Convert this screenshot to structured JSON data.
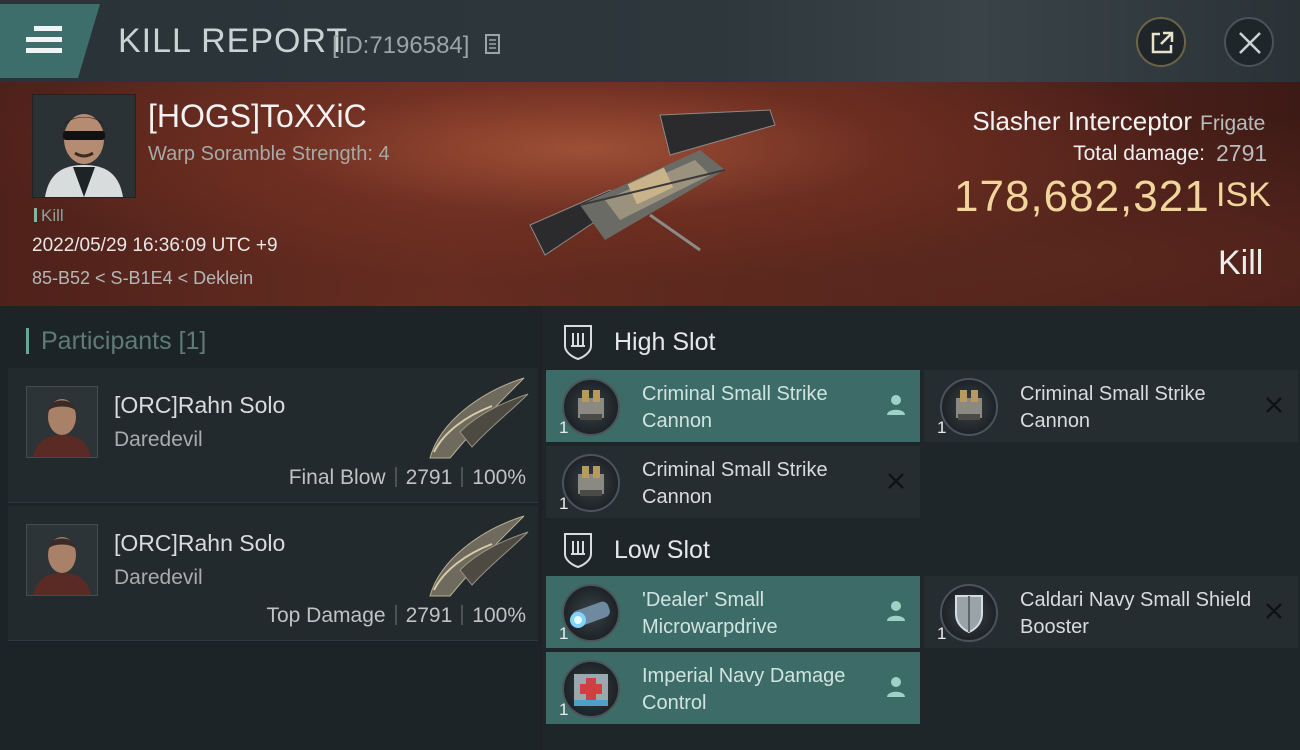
{
  "header": {
    "title": "KILL REPORT",
    "id_label": "[ID:7196584]"
  },
  "victim": {
    "name": "[HOGS]ToXXiC",
    "subtitle": "Warp Soramble Strength: 4",
    "tag": "Kill",
    "datetime": "2022/05/29 16:36:09 UTC +9",
    "location": "85-B52 < S-B1E4 < Deklein",
    "ship_name": "Slasher Interceptor",
    "ship_class": "Frigate",
    "total_damage_label": "Total damage:",
    "total_damage": "2791",
    "isk_value": "178,682,321",
    "isk_unit": "ISK",
    "result": "Kill"
  },
  "participants": {
    "title": "Participants [1]",
    "rows": [
      {
        "name": "[ORC]Rahn Solo",
        "ship": "Daredevil",
        "role": "Final Blow",
        "damage": "2791",
        "percent": "100%"
      },
      {
        "name": "[ORC]Rahn Solo",
        "ship": "Daredevil",
        "role": "Top Damage",
        "damage": "2791",
        "percent": "100%"
      }
    ]
  },
  "fitting": {
    "high_slot_label": "High Slot",
    "low_slot_label": "Low Slot",
    "high_slot": [
      {
        "name": "Criminal Small Strike Cannon",
        "qty": "1",
        "status": "dropped"
      },
      {
        "name": "Criminal Small Strike Cannon",
        "qty": "1",
        "status": "destroyed"
      },
      {
        "name": "Criminal Small Strike Cannon",
        "qty": "1",
        "status": "destroyed"
      }
    ],
    "low_slot": [
      {
        "name": "'Dealer' Small Microwarpdrive",
        "qty": "1",
        "status": "dropped"
      },
      {
        "name": "Caldari Navy Small Shield Booster",
        "qty": "1",
        "status": "destroyed"
      },
      {
        "name": "Imperial Navy Damage Control",
        "qty": "1",
        "status": "dropped"
      }
    ]
  },
  "icons": {
    "menu": "hamburger-icon",
    "copy": "copy-icon",
    "share": "external-link-icon",
    "close": "close-icon",
    "slot": "slot-shield-icon",
    "dropped": "person-icon",
    "destroyed": "x-icon"
  },
  "colors": {
    "accent": "#3d6b67",
    "isk": "#f0d69c",
    "header_bg": "#2a3338",
    "panel_bg": "#1f262a"
  }
}
